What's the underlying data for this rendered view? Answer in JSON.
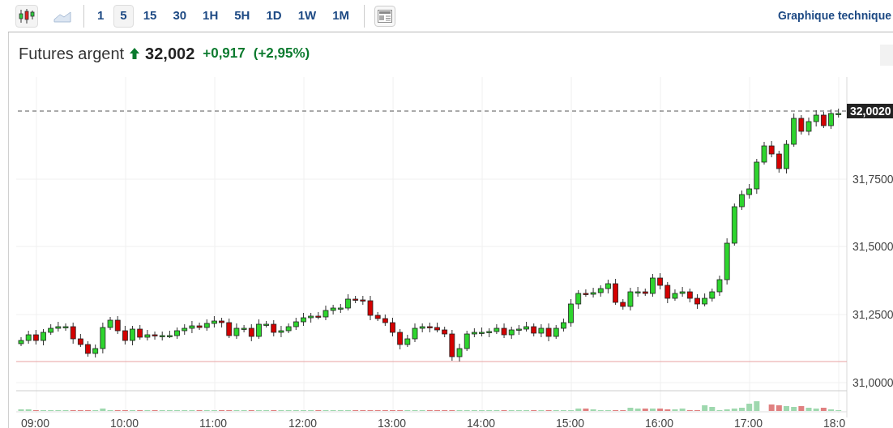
{
  "toolbar": {
    "chart_types": [
      {
        "kind": "candles",
        "selected": true
      },
      {
        "kind": "area",
        "selected": false
      }
    ],
    "timeframes": [
      {
        "label": "1",
        "selected": false
      },
      {
        "label": "5",
        "selected": true
      },
      {
        "label": "15",
        "selected": false
      },
      {
        "label": "30",
        "selected": false
      },
      {
        "label": "1H",
        "selected": false
      },
      {
        "label": "5H",
        "selected": false
      },
      {
        "label": "1D",
        "selected": false
      },
      {
        "label": "1W",
        "selected": false
      },
      {
        "label": "1M",
        "selected": false
      }
    ],
    "link": "Graphique technique"
  },
  "quote": {
    "name": "Futures argent",
    "price_up": true,
    "price": "32,002",
    "change": "+0,917",
    "change_pct": "(+2,95%)"
  },
  "chart": {
    "y_labels": [
      "31,7500",
      "31,5000",
      "31,2500",
      "31,0000"
    ],
    "current_price": "32,0020",
    "x_labels": [
      "09:00",
      "10:00",
      "11:00",
      "12:00",
      "13:00",
      "14:00",
      "15:00",
      "16:00",
      "17:00",
      "18:0"
    ]
  }
}
